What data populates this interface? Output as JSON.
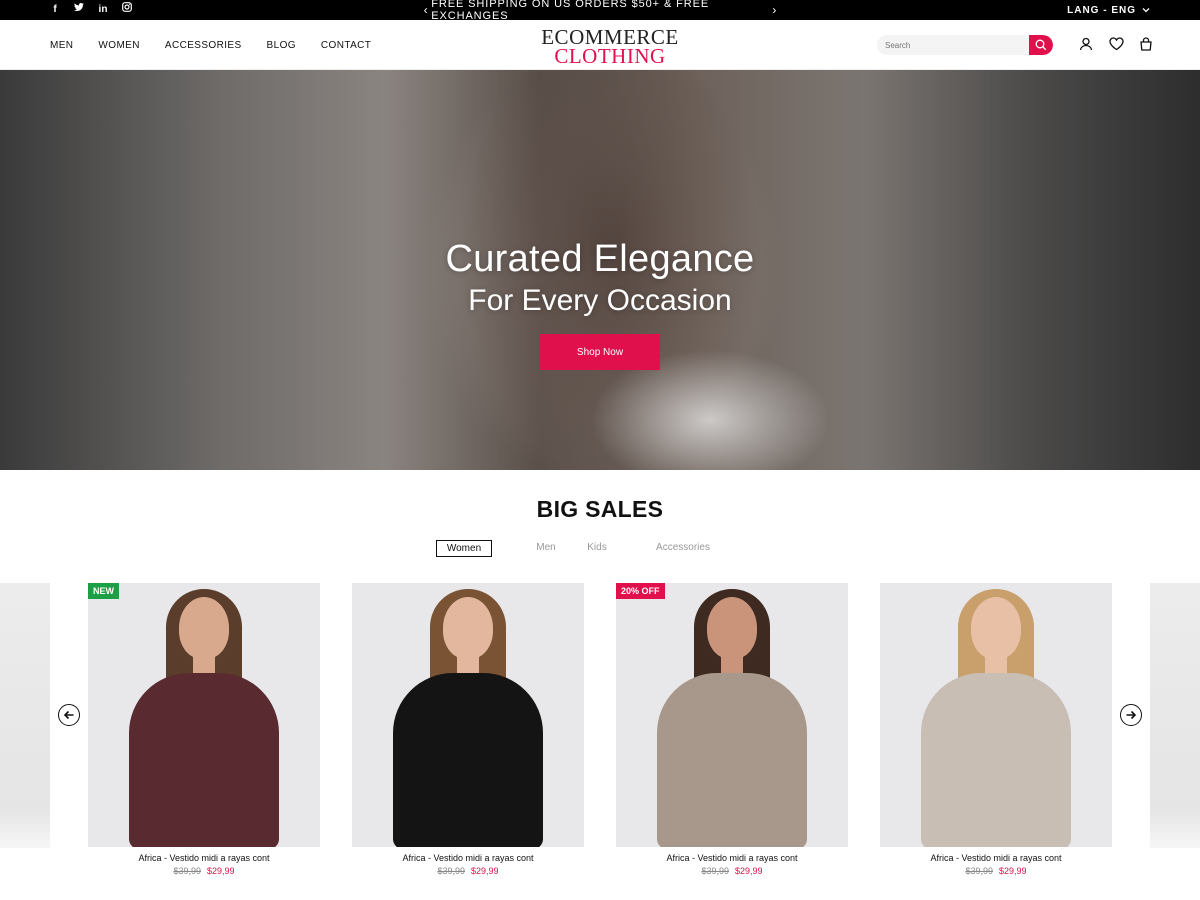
{
  "topbar": {
    "social": [
      "facebook-icon",
      "twitter-icon",
      "linkedin-icon",
      "instagram-icon"
    ],
    "social_glyphs": [
      "f",
      "t",
      "in",
      "◎"
    ],
    "promo_text": "FREE SHIPPING ON US ORDERS $50+ & FREE EXCHANGES",
    "prev_arrow": "‹",
    "next_arrow": "›",
    "lang_label": "LANG - ENG"
  },
  "header": {
    "nav": [
      "MEN",
      "WOMEN",
      "ACCESSORIES",
      "BLOG",
      "CONTACT"
    ],
    "logo_line1": "ECOMMERCE",
    "logo_line2": "CLOTHING",
    "search_placeholder": "Search",
    "icons": [
      "user-icon",
      "heart-icon",
      "bag-icon"
    ]
  },
  "hero": {
    "title": "Curated Elegance",
    "subtitle": "For Every Occasion",
    "cta": "Shop Now"
  },
  "sales": {
    "title": "BIG SALES",
    "tabs": [
      "Women",
      "Men",
      "Kids",
      "Accessories"
    ],
    "active_tab": "Women",
    "products": [
      {
        "badge": "NEW",
        "name": "Africa - Vestido midi a rayas cont",
        "old_price": "$39,99",
        "price": "$29,99",
        "shirt_color": "#5a2a31",
        "hair_color": "#5b3d2b"
      },
      {
        "badge": "",
        "name": "Africa - Vestido midi a rayas cont",
        "old_price": "$39,99",
        "price": "$29,99",
        "shirt_color": "#141414",
        "hair_color": "#7a5234"
      },
      {
        "badge": "20% OFF",
        "name": "Africa - Vestido midi a rayas cont",
        "old_price": "$39,99",
        "price": "$29,99",
        "shirt_color": "#a8978b",
        "hair_color": "#3e2a20"
      },
      {
        "badge": "",
        "name": "Africa - Vestido midi a rayas cont",
        "old_price": "$39,99",
        "price": "$29,99",
        "shirt_color": "#c9beb4",
        "hair_color": "#c99f6c"
      }
    ]
  },
  "colors": {
    "accent": "#e0104d",
    "new_badge": "#1da045",
    "topbar_bg": "#000000"
  }
}
